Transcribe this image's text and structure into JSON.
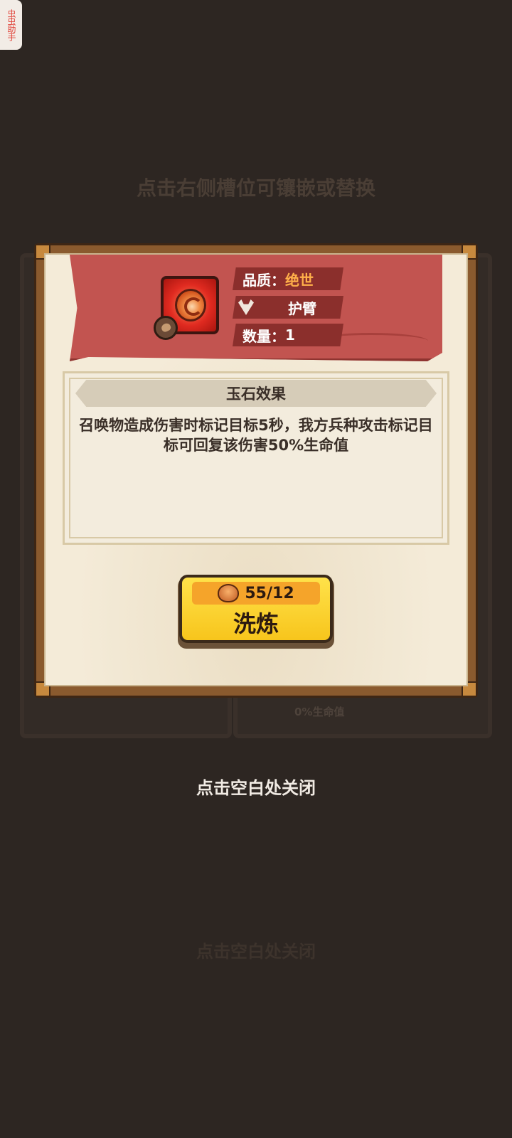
{
  "overlay_helper": {
    "label": "虫虫助手"
  },
  "background": {
    "hint_top": "点击右侧槽位可镶嵌或替换",
    "hint_bottom": "点击空白处关闭",
    "peek_text": "0%生命值"
  },
  "dialog": {
    "item": {
      "icon": "jade-swirl-icon",
      "badge_icon": "seed-icon",
      "quality_label": "品质：",
      "quality_value": "绝世",
      "slot_icon": "wolf-icon",
      "slot_type": "护臂",
      "quantity_label": "数量：",
      "quantity_value": "1"
    },
    "effect": {
      "title": "玉石效果",
      "description": "召唤物造成伤害时标记目标5秒，我方兵种攻击标记目标可回复该伤害50%生命值"
    },
    "refine_button": {
      "cost_icon": "cost-creature-icon",
      "cost": "55/12",
      "label": "洗炼"
    }
  },
  "close_hint": "点击空白处关闭",
  "colors": {
    "backdrop": "#2d2622",
    "banner": "#c25450",
    "quality_value": "#ffb04a",
    "button": "#f7c51c"
  }
}
